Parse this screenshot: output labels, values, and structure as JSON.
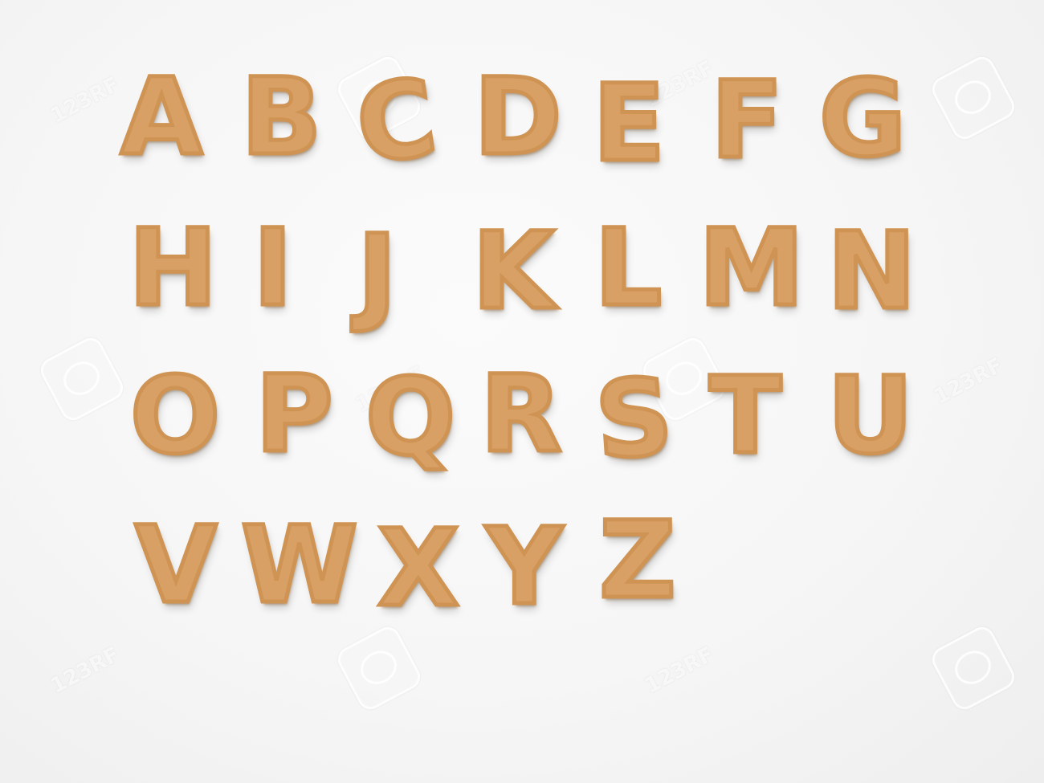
{
  "image": {
    "background_color": "#f7f7f7",
    "cookie_color": "#d8a064",
    "letters": [
      "A",
      "B",
      "C",
      "D",
      "E",
      "F",
      "G",
      "H",
      "I",
      "J",
      "K",
      "L",
      "M",
      "N",
      "O",
      "P",
      "Q",
      "R",
      "S",
      "T",
      "U",
      "V",
      "W",
      "X",
      "Y",
      "Z"
    ]
  },
  "watermark": {
    "text": "123RF"
  }
}
